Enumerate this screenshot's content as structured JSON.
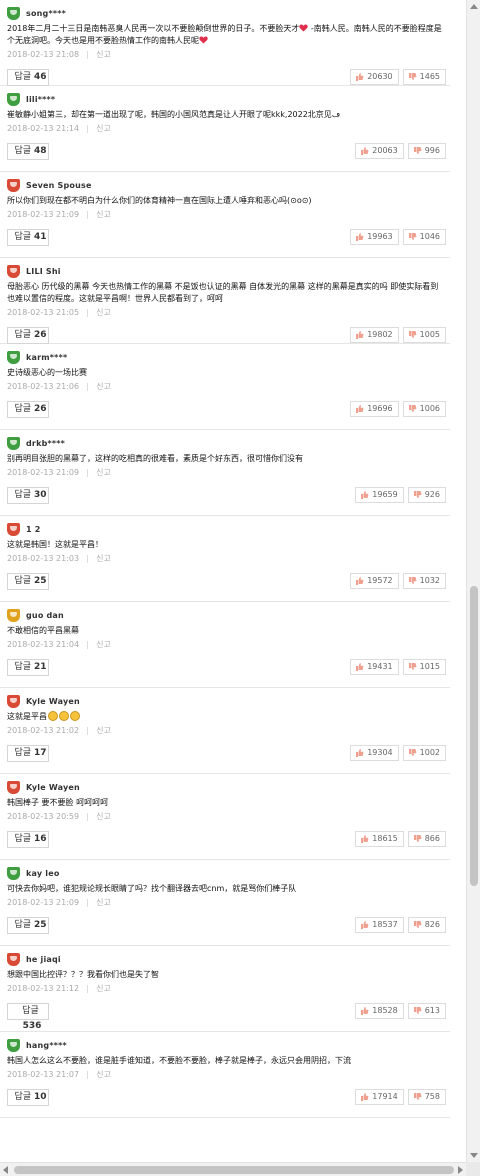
{
  "labels": {
    "report": "신고",
    "reply": "답글"
  },
  "colors": {
    "green_badge": "#3f9e3f",
    "red_badge": "#d94a36",
    "gold_badge": "#e0a21c",
    "heart": "#e0304e"
  },
  "comments": [
    {
      "badge": "green",
      "nick": "song****",
      "text_parts": [
        "2018年二月二十三日是南韩恶臭人民再一次以不要脸颠倒世界的日子。不要脸天才",
        "heart",
        " -南韩人民。南韩人民的不要脸程度是个无底洞吧。今天也是用不要脸热情工作的南韩人民呢",
        "heart"
      ],
      "date": "2018-02-13 21:08",
      "replies": "46",
      "up": "20630",
      "down": "1465"
    },
    {
      "badge": "green",
      "nick": "lili****",
      "text_parts": [
        "崔敏静小姐第三，却在第一道出现了呢，韩国的小国风范真是让人开眼了呢kkk,2022北京见ڡ"
      ],
      "date": "2018-02-13 21:14",
      "replies": "48",
      "up": "20063",
      "down": "996"
    },
    {
      "badge": "red",
      "nick": "Seven Spouse",
      "text_parts": [
        "所以你们到现在都不明白为什么你们的体育精神一直在国际上遭人唾弃和恶心吗(⊙o⊙)"
      ],
      "date": "2018-02-13 21:09",
      "replies": "41",
      "up": "19963",
      "down": "1046"
    },
    {
      "badge": "red",
      "nick": "LILI Shi",
      "text_parts": [
        "母胎恶心 历代级的黑幕 今天也热情工作的黑幕 不是饭也认证的黑幕 自体发光的黑幕 这样的黑幕是真实的吗 即使实际看到也难以置信的程度。这就是平昌啊！世界人民都看到了，呵呵"
      ],
      "date": "2018-02-13 21:05",
      "replies": "26",
      "up": "19802",
      "down": "1005"
    },
    {
      "badge": "green",
      "nick": "karm****",
      "text_parts": [
        "史诗级恶心的一场比赛"
      ],
      "date": "2018-02-13 21:06",
      "replies": "26",
      "up": "19696",
      "down": "1006"
    },
    {
      "badge": "green",
      "nick": "drkb****",
      "text_parts": [
        "别再明目张胆的黑幕了，这样的吃相真的很难看，素质是个好东西，很可惜你们没有"
      ],
      "date": "2018-02-13 21:09",
      "replies": "30",
      "up": "19659",
      "down": "926"
    },
    {
      "badge": "red",
      "nick": "1 2",
      "text_parts": [
        "这就是韩国！这就是平昌！"
      ],
      "date": "2018-02-13 21:03",
      "replies": "25",
      "up": "19572",
      "down": "1032"
    },
    {
      "badge": "gold",
      "nick": "guo dan",
      "text_parts": [
        "不敢相信的平昌黑幕"
      ],
      "date": "2018-02-13 21:04",
      "replies": "21",
      "up": "19431",
      "down": "1015"
    },
    {
      "badge": "red",
      "nick": "Kyle Wayen",
      "text_parts": [
        "这就是平昌",
        "face",
        "face",
        "face"
      ],
      "date": "2018-02-13 21:02",
      "replies": "17",
      "up": "19304",
      "down": "1002"
    },
    {
      "badge": "red",
      "nick": "Kyle Wayen",
      "text_parts": [
        "韩国棒子 要不要脸 呵呵呵呵"
      ],
      "date": "2018-02-13 20:59",
      "replies": "16",
      "up": "18615",
      "down": "866"
    },
    {
      "badge": "green",
      "nick": "kay leo",
      "text_parts": [
        "可快去你妈吧，谁犯规论规长眼睛了吗？找个翻译器去吧cnm，就是骂你们棒子队"
      ],
      "date": "2018-02-13 21:09",
      "replies": "25",
      "up": "18537",
      "down": "826"
    },
    {
      "badge": "red",
      "nick": "he jiaqi",
      "text_parts": [
        "想跟中国比控评？？？我看你们也是失了智"
      ],
      "date": "2018-02-13 21:12",
      "replies": "536",
      "up": "18528",
      "down": "613"
    },
    {
      "badge": "green",
      "nick": "hang****",
      "text_parts": [
        "韩国人怎么这么不要脸，谁是脏手谁知道，不要脸不要脸，棒子就是棒子，永远只会用阴招，下流"
      ],
      "date": "2018-02-13 21:07",
      "replies": "10",
      "up": "17914",
      "down": "758"
    }
  ]
}
